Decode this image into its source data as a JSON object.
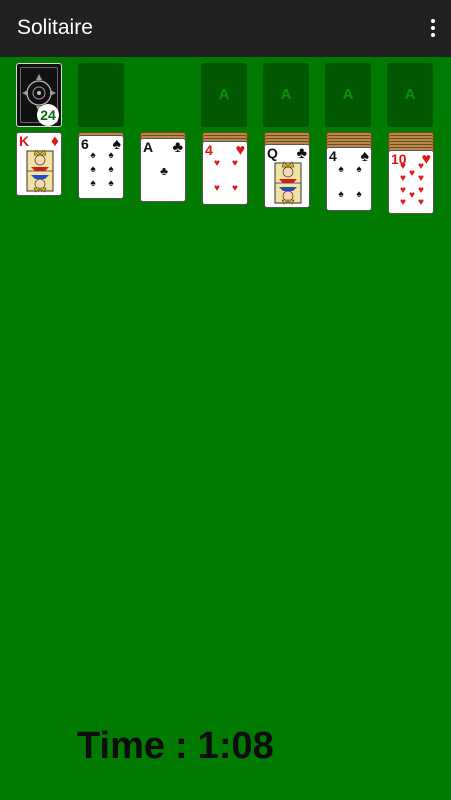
{
  "app_bar": {
    "title": "Solitaire",
    "menu_icon": "more-vert-icon"
  },
  "stock": {
    "count": "24",
    "back_icon": "card-back-emblem-icon"
  },
  "foundations": [
    {
      "label": "A"
    },
    {
      "label": "A"
    },
    {
      "label": "A"
    },
    {
      "label": "A"
    }
  ],
  "tableau": [
    {
      "hidden_cards": 0,
      "top_card": {
        "rank": "K",
        "suit": "♦",
        "suit_name": "diamonds",
        "color": "red"
      }
    },
    {
      "hidden_cards": 1,
      "top_card": {
        "rank": "6",
        "suit": "♠",
        "suit_name": "spades",
        "color": "black"
      }
    },
    {
      "hidden_cards": 2,
      "top_card": {
        "rank": "A",
        "suit": "♣",
        "suit_name": "clubs",
        "color": "black"
      }
    },
    {
      "hidden_cards": 3,
      "top_card": {
        "rank": "4",
        "suit": "♥",
        "suit_name": "hearts",
        "color": "red"
      }
    },
    {
      "hidden_cards": 4,
      "top_card": {
        "rank": "Q",
        "suit": "♣",
        "suit_name": "clubs",
        "color": "black"
      }
    },
    {
      "hidden_cards": 5,
      "top_card": {
        "rank": "4",
        "suit": "♠",
        "suit_name": "spades",
        "color": "black"
      }
    },
    {
      "hidden_cards": 6,
      "top_card": {
        "rank": "10",
        "suit": "♥",
        "suit_name": "hearts",
        "color": "red"
      }
    }
  ],
  "timer": {
    "label": "Time",
    "separator": ":",
    "value": "1:08"
  },
  "colors": {
    "felt": "#007a00",
    "app_bar": "#212121",
    "empty_slot": "#025802",
    "red_suit": "#e01616"
  }
}
